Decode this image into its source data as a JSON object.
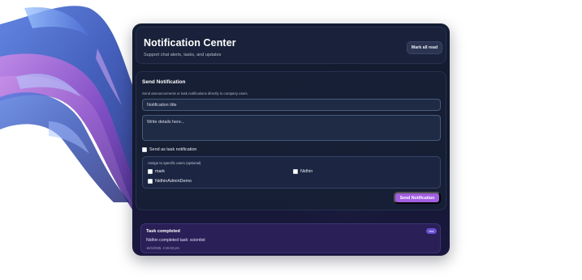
{
  "header": {
    "title": "Notification Center",
    "subtitle": "Support chat alerts, tasks, and updates",
    "mark_all_label": "Mark all read"
  },
  "send": {
    "title": "Send Notification",
    "description": "Send announcements or task notifications directly to company users.",
    "title_placeholder": "Notification title",
    "details_placeholder": "Write details here...",
    "task_checkbox_label": "Send as task notification",
    "assign_title": "Assign to specific users (optional)",
    "users": [
      {
        "name": "mark"
      },
      {
        "name": "Nidhin"
      },
      {
        "name": "NidhinAdminDemo"
      }
    ],
    "send_button_label": "Send Notification"
  },
  "notifications": [
    {
      "title": "Task completed",
      "body": "Nidhin completed task: scientist",
      "time": "16/1/2026, 4:15:03 pm",
      "badge": "new"
    }
  ],
  "colors": {
    "accent": "#a05ee0",
    "panel": "#121a2e",
    "notification_bg": "#2a1f57"
  }
}
